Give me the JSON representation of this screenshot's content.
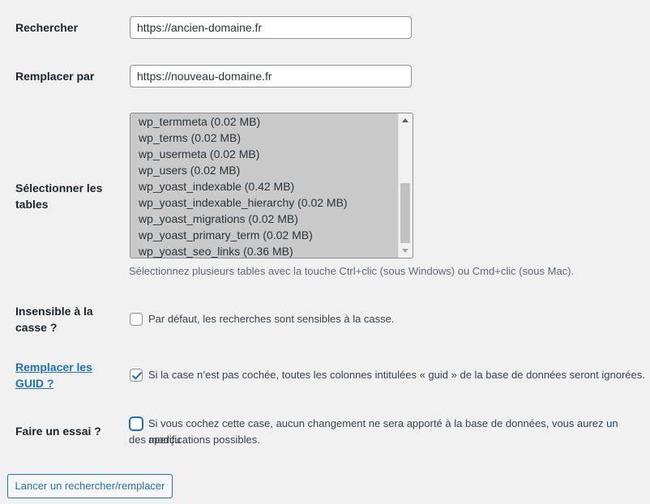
{
  "search": {
    "label": "Rechercher",
    "value": "https://ancien-domaine.fr"
  },
  "replace": {
    "label": "Remplacer par",
    "value": "https://nouveau-domaine.fr"
  },
  "tables": {
    "label_line1": "Sélectionner les",
    "label_line2": "tables",
    "options": [
      "wp_termmeta (0.02 MB)",
      "wp_terms (0.02 MB)",
      "wp_usermeta (0.02 MB)",
      "wp_users (0.02 MB)",
      "wp_yoast_indexable (0.42 MB)",
      "wp_yoast_indexable_hierarchy (0.02 MB)",
      "wp_yoast_migrations (0.02 MB)",
      "wp_yoast_primary_term (0.02 MB)",
      "wp_yoast_seo_links (0.36 MB)"
    ],
    "help": "Sélectionnez plusieurs tables avec la touche Ctrl+clic (sous Windows) ou Cmd+clic (sous Mac)."
  },
  "case_insensitive": {
    "label_line1": "Insensible à la",
    "label_line2": "casse ?",
    "checked": false,
    "text": "Par défaut, les recherches sont sensibles à la casse."
  },
  "replace_guids": {
    "label_line1": "Remplacer les",
    "label_line2": "GUID ?",
    "checked": true,
    "text": "Si la case n’est pas cochée, toutes les colonnes intitulées « guid » de la base de données seront ignorées."
  },
  "dry_run": {
    "label": "Faire un essai ?",
    "checked": false,
    "text_line1": "Si vous cochez cette case, aucun changement ne sera apporté à la base de données, vous aurez un aperçu",
    "text_line2": "des modifications possibles."
  },
  "submit": {
    "label": "Lancer un rechercher/remplacer"
  },
  "colors": {
    "accent": "#2271b1",
    "background": "#f0f0f1",
    "select_bg": "#c9c9c9"
  }
}
